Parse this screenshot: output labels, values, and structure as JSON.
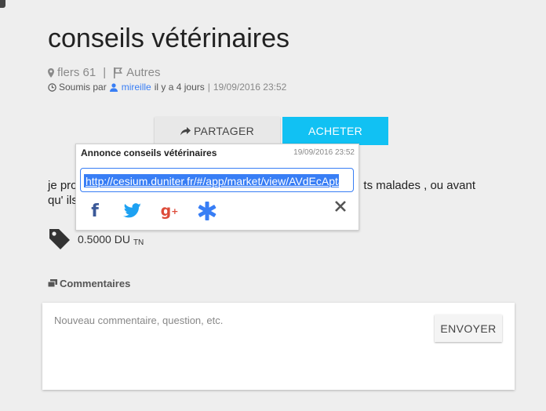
{
  "listing": {
    "title": "conseils vétérinaires",
    "location": "flers 61",
    "separator": "|",
    "category": "Autres",
    "submitted_by": "Soumis par",
    "author": "mireille",
    "age": "il y a 4 jours",
    "date_sep": "|",
    "date": "19/09/2016 23:52"
  },
  "actions": {
    "share_label": "PARTAGER",
    "buy_label": "ACHETER"
  },
  "description": {
    "line1_start": "je pro",
    "line1_end": "ts malades , ou avant",
    "line2_start": "qu' ils"
  },
  "price": {
    "amount": "0.5000 DU",
    "unit": "TN"
  },
  "comments": {
    "heading": "Commentaires",
    "placeholder": "Nouveau commentaire, question, etc.",
    "send_label": "ENVOYER"
  },
  "share_popover": {
    "title": "Annonce conseils vétérinaires",
    "date": "19/09/2016 23:52",
    "url": "http://cesium.duniter.fr/#/app/market/view/AVdEcAptaGHRo"
  },
  "icons": {
    "location": "map-marker-icon",
    "category": "flag-icon",
    "time": "clock-icon",
    "user": "person-icon",
    "share": "share-arrow-icon",
    "price": "tag-icon",
    "comments": "chat-bubbles-icon",
    "facebook": "facebook-icon",
    "twitter": "twitter-icon",
    "googleplus": "google-plus-icon",
    "asterisk": "asterisk-icon",
    "close": "close-icon"
  },
  "colors": {
    "accent": "#11c1f3",
    "link": "#387ef5",
    "facebook": "#3b5998",
    "twitter": "#1da1f2",
    "googleplus": "#dd4b39"
  }
}
